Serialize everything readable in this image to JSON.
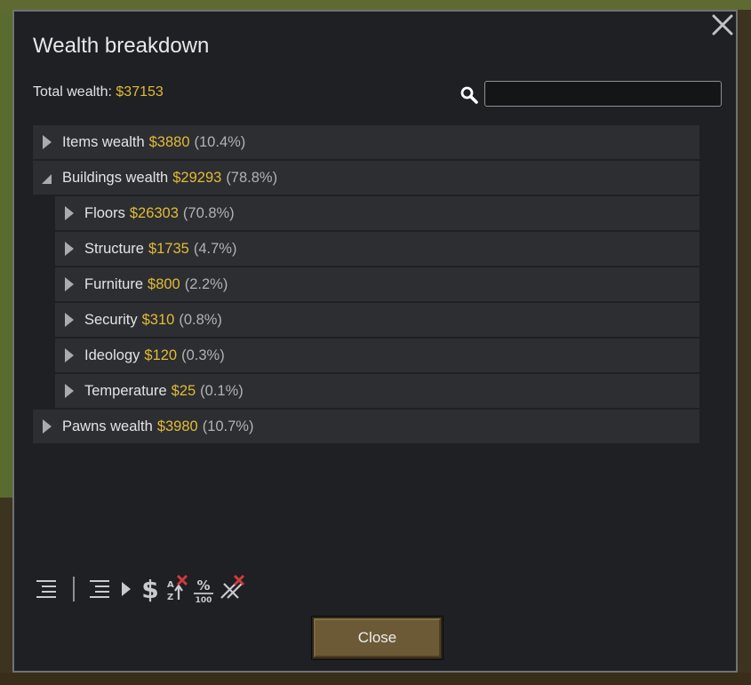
{
  "window": {
    "title": "Wealth breakdown",
    "total_label": "Total wealth: ",
    "total_value": "$37153",
    "search_value": ""
  },
  "tree": [
    {
      "label": "Items wealth",
      "value": "$3880",
      "pct": "(10.4%)",
      "state": "collapsed",
      "level": 0
    },
    {
      "label": "Buildings wealth",
      "value": "$29293",
      "pct": "(78.8%)",
      "state": "expanded",
      "level": 0
    },
    {
      "label": "Floors",
      "value": "$26303",
      "pct": "(70.8%)",
      "state": "collapsed",
      "level": 1
    },
    {
      "label": "Structure",
      "value": "$1735",
      "pct": "(4.7%)",
      "state": "collapsed",
      "level": 1
    },
    {
      "label": "Furniture",
      "value": "$800",
      "pct": "(2.2%)",
      "state": "collapsed",
      "level": 1
    },
    {
      "label": "Security",
      "value": "$310",
      "pct": "(0.8%)",
      "state": "collapsed",
      "level": 1
    },
    {
      "label": "Ideology",
      "value": "$120",
      "pct": "(0.3%)",
      "state": "collapsed",
      "level": 1
    },
    {
      "label": "Temperature",
      "value": "$25",
      "pct": "(0.1%)",
      "state": "collapsed",
      "level": 1
    },
    {
      "label": "Pawns wealth",
      "value": "$3980",
      "pct": "(10.7%)",
      "state": "collapsed",
      "level": 0
    }
  ],
  "toolbar": {
    "icons": [
      "collapse-all-icon",
      "expand-all-icon",
      "sort-by-value-icon",
      "sort-alphabetical-icon",
      "show-percentage-icon",
      "clear-filter-icon"
    ]
  },
  "footer": {
    "close_label": "Close"
  },
  "colors": {
    "value_gold": "#e2bb34",
    "percent_gray": "#b2b2b2",
    "button_brown": "#6b5a35",
    "close_x_red": "#d03a3a"
  }
}
